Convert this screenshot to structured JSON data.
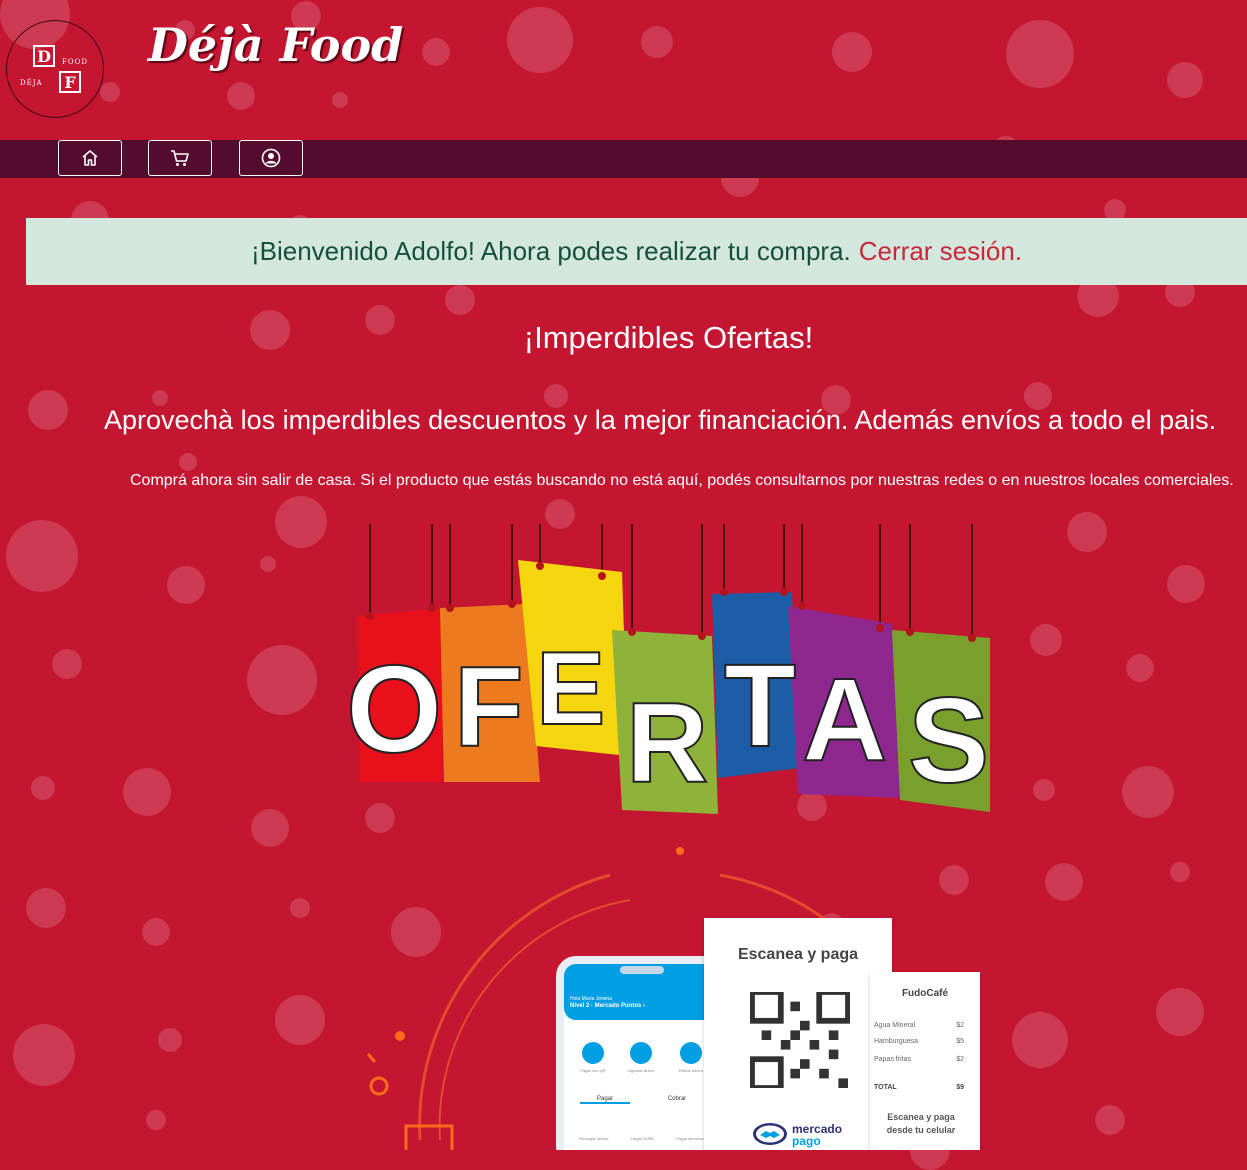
{
  "brand": {
    "logo_top_letter": "D",
    "logo_bottom_letter": "F",
    "logo_word_top": "FOOD",
    "logo_word_bottom": "DÉJA",
    "name": "Déjà Food"
  },
  "nav": {
    "items": [
      {
        "icon": "home-icon"
      },
      {
        "icon": "cart-icon"
      },
      {
        "icon": "user-icon"
      }
    ]
  },
  "alert": {
    "message": "¡Bienvenido Adolfo! Ahora podes realizar tu compra.",
    "logout_link": "Cerrar sesión."
  },
  "offers": {
    "heading": "¡Imperdibles Ofertas!",
    "subtitle": "Aprovechà los imperdibles descuentos y la mejor financiación. Además envíos a todo el pais.",
    "fine_print": "Comprá ahora sin salir de casa. Si el producto que estás buscando no está aquí, podés consultarnos por nuestras redes o en nuestros locales comerciales.",
    "banner_word": "OFERTAS"
  },
  "promo": {
    "scan_title": "Escanea y paga",
    "phone_user": "Hola María Jimena",
    "phone_level": "Nivel 2 · Mercado Puntos ›",
    "phone_actions": [
      "Pagar con QR",
      "Ingresar dinero",
      "Retirar dinero"
    ],
    "phone_tabs": [
      "Pagar",
      "Cobrar"
    ],
    "phone_shortcuts": [
      "Recargar celular",
      "Cargar SUBE",
      "Pagar servicios"
    ],
    "mp_brand_1": "mercado",
    "mp_brand_2": "pago",
    "receipt": {
      "shop": "FudoCafé",
      "items": [
        {
          "name": "Agua Mineral",
          "price": "$2"
        },
        {
          "name": "Hamburguesa",
          "price": "$5"
        },
        {
          "name": "Papas fritas",
          "price": "$2"
        }
      ],
      "total_label": "TOTAL",
      "total_value": "$9",
      "footer_1": "Escanea y paga",
      "footer_2": "desde tu celular"
    }
  },
  "colors": {
    "background": "#c41531",
    "navbar": "#540c2e",
    "alert_bg": "#d4e7df",
    "alert_text": "#15503c",
    "link": "#c8283a",
    "mp_blue": "#009ee3"
  }
}
